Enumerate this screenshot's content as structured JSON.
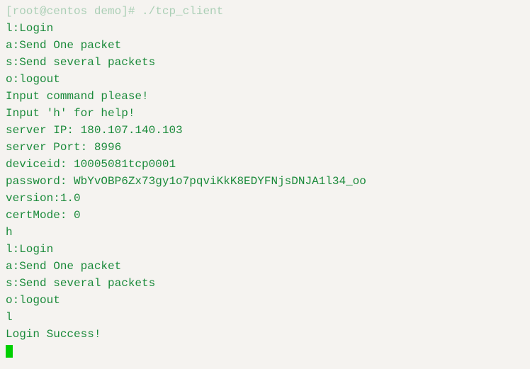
{
  "lines": [
    {
      "text": "[root@centos demo]# ./tcp_client",
      "faded": true
    },
    {
      "text": "l:Login",
      "faded": false
    },
    {
      "text": "a:Send One packet",
      "faded": false
    },
    {
      "text": "s:Send several packets",
      "faded": false
    },
    {
      "text": "o:logout",
      "faded": false
    },
    {
      "text": "Input command please!",
      "faded": false
    },
    {
      "text": "Input 'h' for help!",
      "faded": false
    },
    {
      "text": "server IP: 180.107.140.103",
      "faded": false
    },
    {
      "text": "server Port: 8996",
      "faded": false
    },
    {
      "text": "deviceid: 10005081tcp0001",
      "faded": false
    },
    {
      "text": "password: WbYvOBP6Zx73gy1o7pqviKkK8EDYFNjsDNJA1l34_oo",
      "faded": false
    },
    {
      "text": "version:1.0",
      "faded": false
    },
    {
      "text": "certMode: 0",
      "faded": false
    },
    {
      "text": "h",
      "faded": false
    },
    {
      "text": "l:Login",
      "faded": false
    },
    {
      "text": "a:Send One packet",
      "faded": false
    },
    {
      "text": "s:Send several packets",
      "faded": false
    },
    {
      "text": "o:logout",
      "faded": false
    },
    {
      "text": "l",
      "faded": false
    },
    {
      "text": "Login Success!",
      "faded": false
    }
  ]
}
